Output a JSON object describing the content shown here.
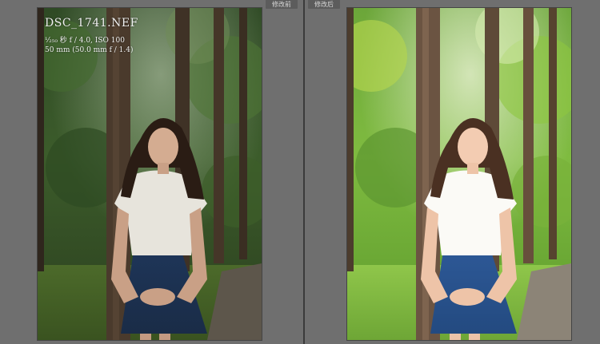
{
  "labels": {
    "before": "修改前",
    "after": "修改后"
  },
  "info_overlay": {
    "filename": "DSC_1741.NEF",
    "exposure": "¹⁄₂₅₀ 秒 f / 4.0, ISO 100",
    "lens": "50 mm (50.0 mm f / 1.4)"
  },
  "icons": {
    "photo_before": "portrait-photo-before",
    "photo_after": "portrait-photo-after"
  },
  "colors": {
    "app_background": "#6f6f6f",
    "divider": "#3b3b3b",
    "label_background": "#5c5c5c",
    "label_text": "#d8d8d8"
  }
}
